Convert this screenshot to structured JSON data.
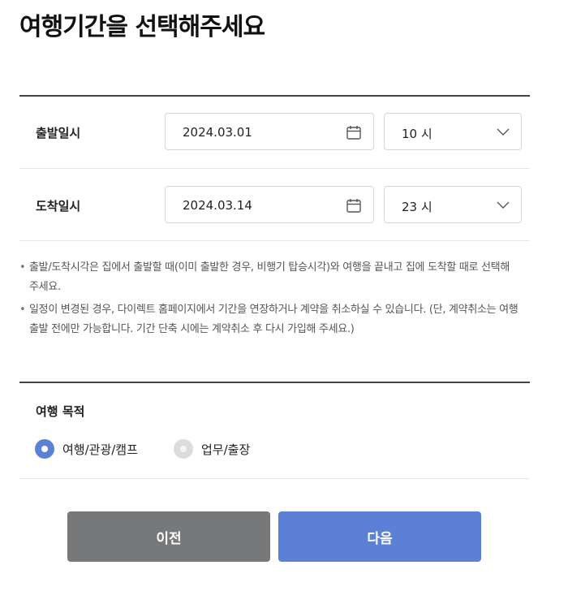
{
  "page_title": "여행기간을 선택해주세요",
  "departure": {
    "label": "출발일시",
    "date": "2024.03.01",
    "hour": "10 시"
  },
  "arrival": {
    "label": "도착일시",
    "date": "2024.03.14",
    "hour": "23 시"
  },
  "notes": [
    {
      "line1": "출발/도착시각은 집에서 출발할 때(이미 출발한 경우, 비행기 탑승시각)와 여행을 끝내고 집에 도착할 때로 선택해",
      "line2": "주세요."
    },
    {
      "line1": "일정이 변경된 경우, 다이렉트 홈페이지에서 기간을 연장하거나 계약을 취소하실 수 있습니다. (단, 계약취소는 여행",
      "line2": "출발 전에만 가능합니다. 기간 단축 시에는 계약취소 후 다시 가입해 주세요.)"
    }
  ],
  "bullet": "•",
  "purpose": {
    "title": "여행 목적",
    "options": [
      {
        "label": "여행/관광/캠프",
        "selected": true
      },
      {
        "label": "업무/출장",
        "selected": false
      }
    ]
  },
  "buttons": {
    "prev": "이전",
    "next": "다음"
  },
  "colors": {
    "accent": "#5b80d6",
    "prev_button": "#77787a"
  },
  "icons": {
    "date": "calendar-icon",
    "select": "chevron-down-icon"
  }
}
